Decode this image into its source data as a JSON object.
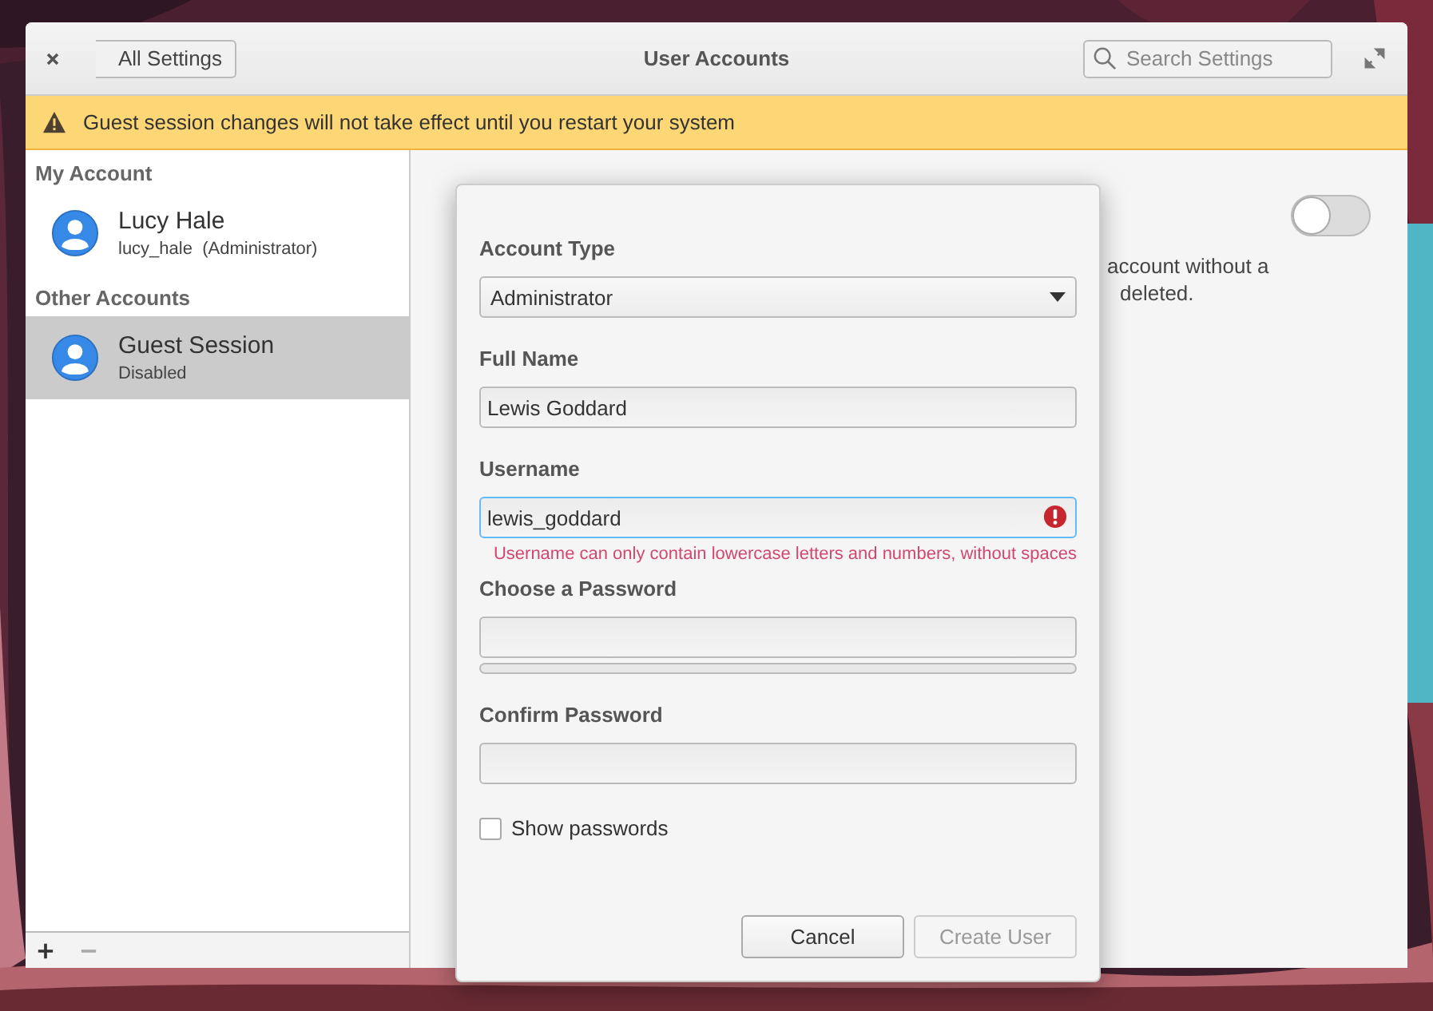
{
  "window": {
    "title": "User Accounts",
    "back_button": "All Settings",
    "search": {
      "placeholder": "Search Settings"
    }
  },
  "infobar": {
    "message": "Guest session changes will not take effect until you restart your system"
  },
  "sidebar": {
    "sections": [
      {
        "heading": "My Account",
        "accounts": [
          {
            "name": "Lucy Hale",
            "detail": "lucy_hale  (Administrator)",
            "selected": false
          }
        ]
      },
      {
        "heading": "Other Accounts",
        "accounts": [
          {
            "name": "Guest Session",
            "detail": "Disabled",
            "selected": true
          }
        ]
      }
    ],
    "toolbar": {
      "remove_disabled": true
    }
  },
  "content": {
    "switch": {
      "on": false
    },
    "description_lines": [
      "account without a",
      "deleted."
    ]
  },
  "dialog": {
    "fields": [
      {
        "kind": "dropdown",
        "label": "Account Type",
        "value": "Administrator"
      },
      {
        "kind": "text",
        "label": "Full Name",
        "value": "Lewis Goddard",
        "focused": false
      },
      {
        "kind": "text",
        "label": "Username",
        "value": "lewis_goddard",
        "focused": true,
        "error": "Username can only contain lowercase letters and numbers, without spaces"
      },
      {
        "kind": "password",
        "label": "Choose a Password",
        "strength": {
          "level": 0
        }
      },
      {
        "kind": "password",
        "label": "Confirm Password"
      }
    ],
    "checkbox": {
      "label": "Show passwords",
      "checked": false
    },
    "buttons": [
      {
        "label": "Cancel",
        "disabled": false
      },
      {
        "label": "Create User",
        "disabled": true
      }
    ]
  }
}
